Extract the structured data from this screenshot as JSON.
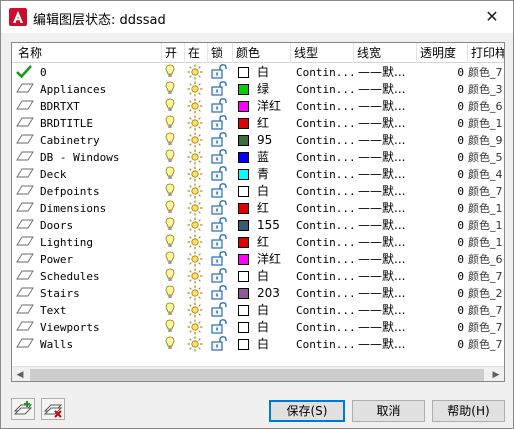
{
  "window": {
    "title": "编辑图层状态: ddssad",
    "close_glyph": "✕"
  },
  "columns": [
    "名称",
    "开",
    "在",
    "锁",
    "颜色",
    "线型",
    "线宽",
    "透明度",
    "打印样"
  ],
  "layers": [
    {
      "name": "0",
      "current": true,
      "color_hex": "#ffffff",
      "color_name": "白",
      "linetype": "Contin...",
      "lineweight": "——默...",
      "transparency": "0",
      "plot_style": "颜色_7"
    },
    {
      "name": "Appliances",
      "current": false,
      "color_hex": "#00d000",
      "color_name": "绿",
      "linetype": "Contin...",
      "lineweight": "——默...",
      "transparency": "0",
      "plot_style": "颜色_3"
    },
    {
      "name": "BDRTXT",
      "current": false,
      "color_hex": "#ff00ff",
      "color_name": "洋红",
      "linetype": "Contin...",
      "lineweight": "——默...",
      "transparency": "0",
      "plot_style": "颜色_6"
    },
    {
      "name": "BRDTITLE",
      "current": false,
      "color_hex": "#e00000",
      "color_name": "红",
      "linetype": "Contin...",
      "lineweight": "——默...",
      "transparency": "0",
      "plot_style": "颜色_1"
    },
    {
      "name": "Cabinetry",
      "current": false,
      "color_hex": "#3a6e3a",
      "color_name": "95",
      "linetype": "Contin...",
      "lineweight": "——默...",
      "transparency": "0",
      "plot_style": "颜色_9"
    },
    {
      "name": "DB - Windows",
      "current": false,
      "color_hex": "#0000ff",
      "color_name": "蓝",
      "linetype": "Contin...",
      "lineweight": "——默...",
      "transparency": "0",
      "plot_style": "颜色_5"
    },
    {
      "name": "Deck",
      "current": false,
      "color_hex": "#00ffff",
      "color_name": "青",
      "linetype": "Contin...",
      "lineweight": "——默...",
      "transparency": "0",
      "plot_style": "颜色_4"
    },
    {
      "name": "Defpoints",
      "current": false,
      "color_hex": "#ffffff",
      "color_name": "白",
      "linetype": "Contin...",
      "lineweight": "——默...",
      "transparency": "0",
      "plot_style": "颜色_7"
    },
    {
      "name": "Dimensions",
      "current": false,
      "color_hex": "#e00000",
      "color_name": "红",
      "linetype": "Contin...",
      "lineweight": "——默...",
      "transparency": "0",
      "plot_style": "颜色_1"
    },
    {
      "name": "Doors",
      "current": false,
      "color_hex": "#3c5a6e",
      "color_name": "155",
      "linetype": "Contin...",
      "lineweight": "——默...",
      "transparency": "0",
      "plot_style": "颜色_1"
    },
    {
      "name": "Lighting",
      "current": false,
      "color_hex": "#e00000",
      "color_name": "红",
      "linetype": "Contin...",
      "lineweight": "——默...",
      "transparency": "0",
      "plot_style": "颜色_1"
    },
    {
      "name": "Power",
      "current": false,
      "color_hex": "#ff00ff",
      "color_name": "洋红",
      "linetype": "Contin...",
      "lineweight": "——默...",
      "transparency": "0",
      "plot_style": "颜色_6"
    },
    {
      "name": "Schedules",
      "current": false,
      "color_hex": "#ffffff",
      "color_name": "白",
      "linetype": "Contin...",
      "lineweight": "——默...",
      "transparency": "0",
      "plot_style": "颜色_7"
    },
    {
      "name": "Stairs",
      "current": false,
      "color_hex": "#8e5a9a",
      "color_name": "203",
      "linetype": "Contin...",
      "lineweight": "——默...",
      "transparency": "0",
      "plot_style": "颜色_2"
    },
    {
      "name": "Text",
      "current": false,
      "color_hex": "#ffffff",
      "color_name": "白",
      "linetype": "Contin...",
      "lineweight": "——默...",
      "transparency": "0",
      "plot_style": "颜色_7"
    },
    {
      "name": "Viewports",
      "current": false,
      "color_hex": "#ffffff",
      "color_name": "白",
      "linetype": "Contin...",
      "lineweight": "——默...",
      "transparency": "0",
      "plot_style": "颜色_7"
    },
    {
      "name": "Walls",
      "current": false,
      "color_hex": "#ffffff",
      "color_name": "白",
      "linetype": "Contin...",
      "lineweight": "——默...",
      "transparency": "0",
      "plot_style": "颜色_7"
    }
  ],
  "icons": {
    "on": "lightbulb-icon",
    "thaw": "sun-icon",
    "lock": "unlocked-padlock-icon",
    "current": "green-check-icon",
    "layer": "layer-sheet-icon"
  },
  "buttons": {
    "save": "保存(S)",
    "cancel": "取消",
    "help": "帮助(H)"
  },
  "accent": "#0078d7"
}
